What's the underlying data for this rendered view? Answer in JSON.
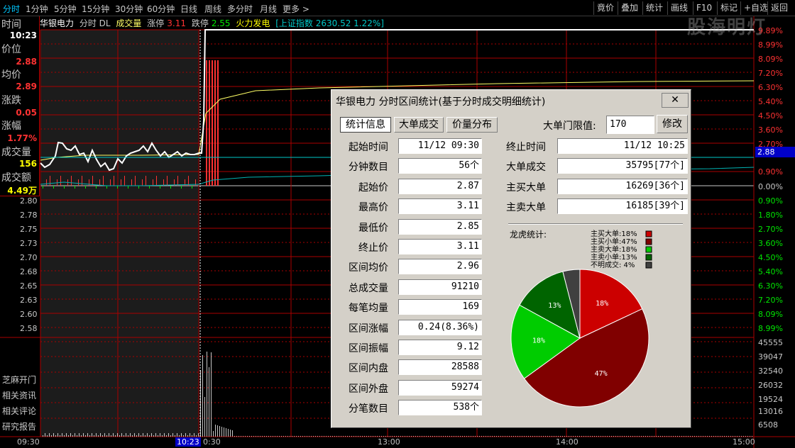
{
  "toolbar": {
    "left": [
      "分时",
      "1分钟",
      "5分钟",
      "15分钟",
      "30分钟",
      "60分钟",
      "日线",
      "周线",
      "多分时",
      "月线",
      "更多"
    ],
    "right": [
      "竟价",
      "叠加",
      "统计",
      "画线",
      "F10",
      "标记",
      "+自选",
      "返回"
    ],
    "watermark": "股海明灯"
  },
  "infoline": {
    "stock": "华银电力",
    "mode": "分时 DL",
    "volume_label": "成交量",
    "limit_up_label": "涨停",
    "limit_up": "3.11",
    "limit_down_label": "跌停",
    "limit_down": "2.55",
    "sector": "火力发电",
    "index": "[上证指数 2630.52 1.22%]"
  },
  "leftpanel": {
    "time_label": "时间",
    "time": "10:23",
    "price_label": "价位",
    "price": "2.88",
    "avg_label": "均价",
    "avg": "2.89",
    "change_label": "涨跌",
    "change": "0.05",
    "pct_label": "涨幅",
    "pct": "1.77%",
    "vol_label": "成交量",
    "vol": "156",
    "amt_label": "成交额",
    "amt": "4.49万"
  },
  "left_links": [
    "芝麻开门",
    "相关资讯",
    "相关评论",
    "研究报告"
  ],
  "y_left": [
    "2.80",
    "2.78",
    "2.75",
    "2.73",
    "2.70",
    "2.68",
    "2.65",
    "2.63",
    "2.60",
    "2.58"
  ],
  "y_right_top": [
    "9.89%",
    "8.99%",
    "8.09%",
    "7.20%",
    "6.30%",
    "5.40%",
    "4.50%",
    "3.60%",
    "2.70%",
    "1.80%",
    "0.90%",
    "0.00%"
  ],
  "y_right_bottom": [
    "0.90%",
    "1.80%",
    "2.70%",
    "3.60%",
    "4.50%",
    "5.40%",
    "6.30%",
    "7.20%",
    "8.09%",
    "8.99%"
  ],
  "y_vol": [
    "45555",
    "39047",
    "32540",
    "26032",
    "19524",
    "13016",
    "6508"
  ],
  "cursor_price": "2.88",
  "x_labels": [
    "09:30",
    "10:23",
    "0:30",
    "13:00",
    "14:00",
    "15:00"
  ],
  "colors": {
    "up": "#ff3232",
    "down": "#00e600",
    "grid": "#aa0000",
    "price_line": "#ffffff",
    "avg_line": "#ffff00",
    "cyan": "#00c8c8"
  },
  "dialog": {
    "title": "华银电力 分时区间统计(基于分时成交明细统计)",
    "close": "✕",
    "tabs": [
      "统计信息",
      "大单成交",
      "价量分布"
    ],
    "threshold_label": "大单门限值:",
    "threshold_value": "170",
    "modify_button": "修改",
    "left_rows": [
      {
        "label": "起始时间",
        "value": "11/12 09:30"
      },
      {
        "label": "分钟数目",
        "value": "56个"
      },
      {
        "label": "起始价",
        "value": "2.87"
      },
      {
        "label": "最高价",
        "value": "3.11"
      },
      {
        "label": "最低价",
        "value": "2.85"
      },
      {
        "label": "终止价",
        "value": "3.11"
      },
      {
        "label": "区间均价",
        "value": "2.96"
      },
      {
        "label": "总成交量",
        "value": "91210"
      },
      {
        "label": "每笔均量",
        "value": "169"
      },
      {
        "label": "区间涨幅",
        "value": "0.24(8.36%)"
      },
      {
        "label": "区间振幅",
        "value": "9.12"
      },
      {
        "label": "区间内盘",
        "value": "28588"
      },
      {
        "label": "区间外盘",
        "value": "59274"
      },
      {
        "label": "分笔数目",
        "value": "538个"
      }
    ],
    "right_rows": [
      {
        "label": "终止时间",
        "value": "11/12 10:25"
      },
      {
        "label": "大单成交",
        "value": "35795[77个]"
      },
      {
        "label": "主买大单",
        "value": "16269[36个]"
      },
      {
        "label": "主卖大单",
        "value": "16185[39个]"
      }
    ],
    "pie_title": "龙虎统计:"
  },
  "chart_data": {
    "type": "pie",
    "title": "龙虎统计:",
    "slices": [
      {
        "name": "主买大单",
        "value": 18,
        "label": "18%",
        "color": "#cc0000"
      },
      {
        "name": "主买小单",
        "value": 47,
        "label": "47%",
        "color": "#800000"
      },
      {
        "name": "主卖大单",
        "value": 18,
        "label": "18%",
        "color": "#00cc00"
      },
      {
        "name": "主卖小单",
        "value": 13,
        "label": "13%",
        "color": "#006400"
      },
      {
        "name": "不明成交",
        "value": 4,
        "label": "4%",
        "color": "#404040"
      }
    ]
  }
}
